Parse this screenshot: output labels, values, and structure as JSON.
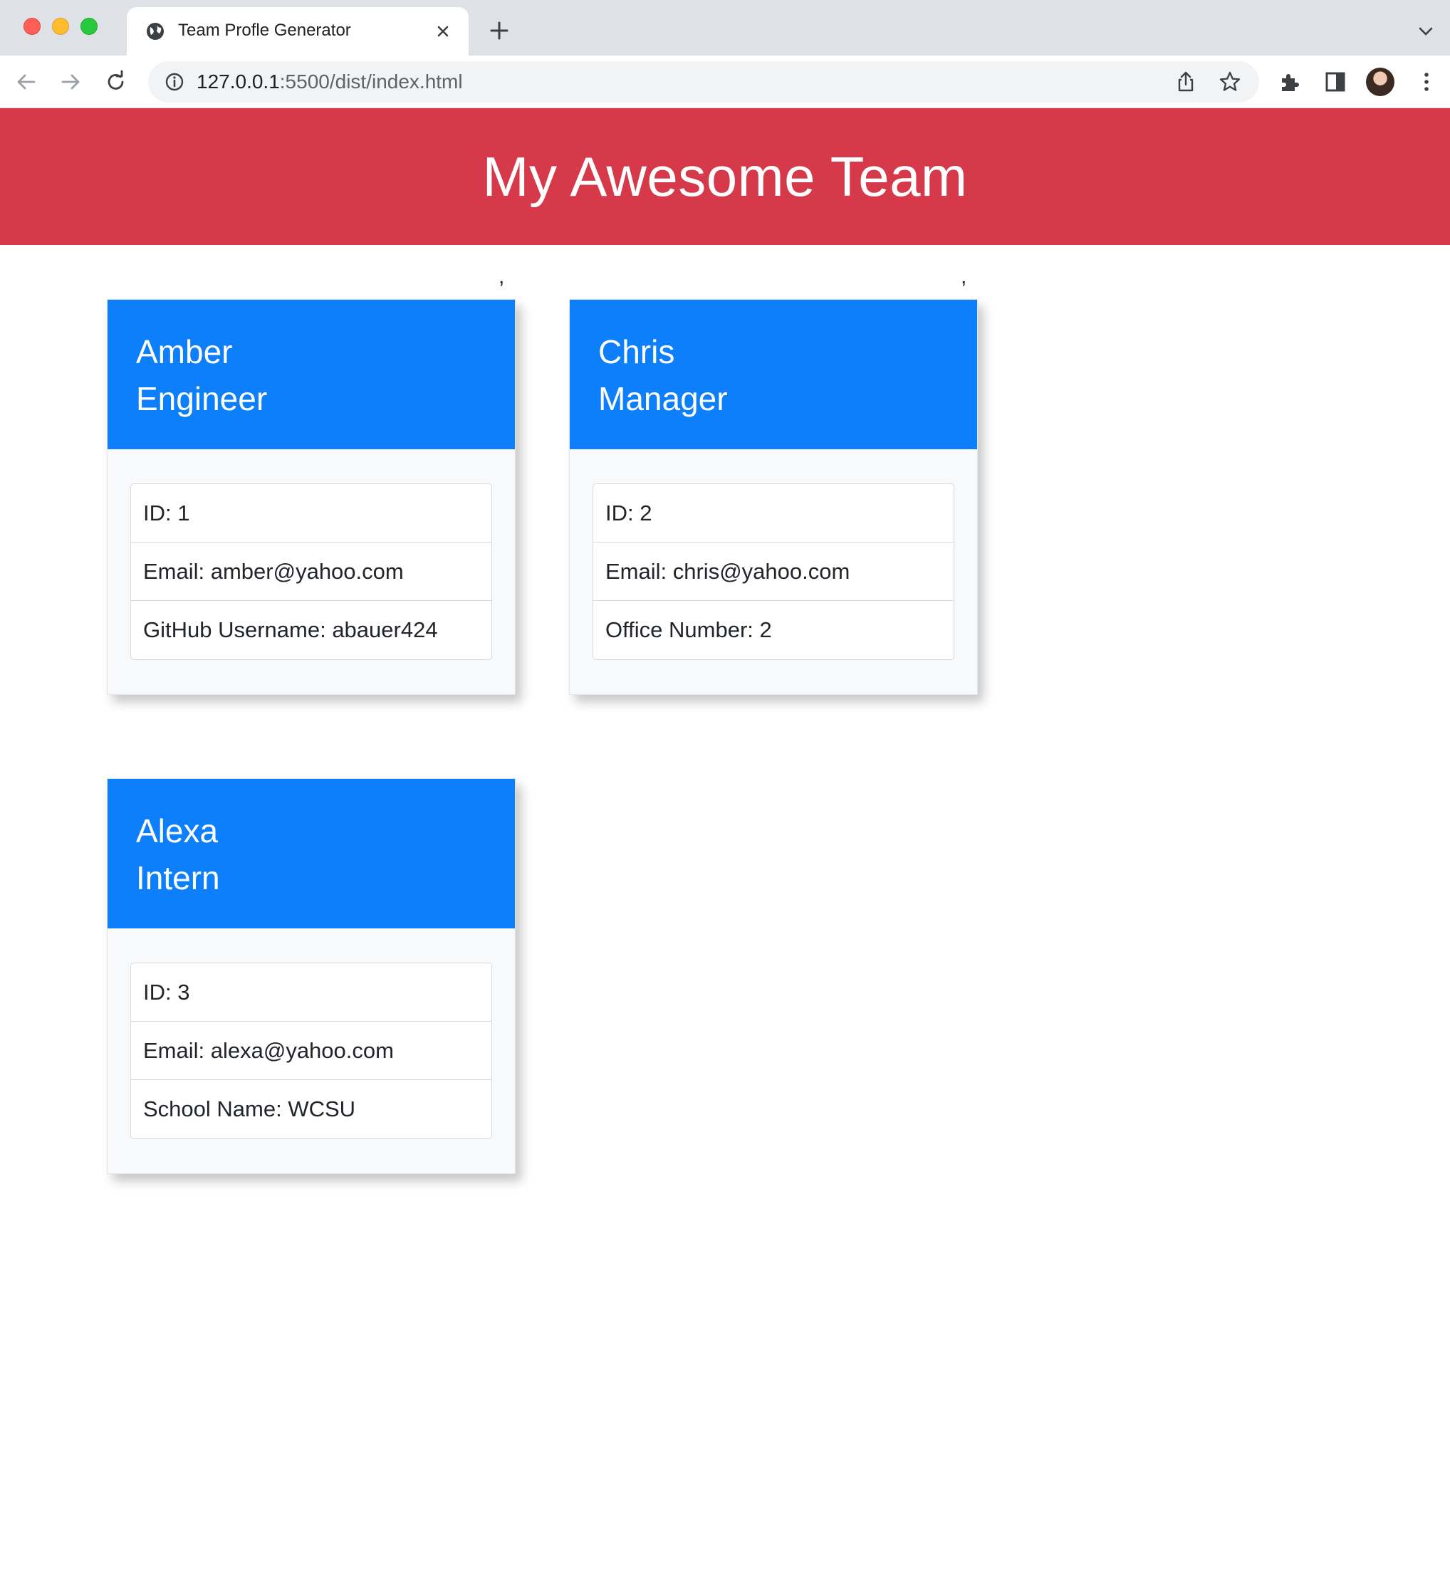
{
  "browser": {
    "tab_title": "Team Profle Generator",
    "url_host": "127.0.0.1",
    "url_rest": ":5500/dist/index.html"
  },
  "page": {
    "heading": "My Awesome Team",
    "stray_marks": [
      ",",
      ","
    ]
  },
  "employees": [
    {
      "name": "Amber",
      "role": "Engineer",
      "details": [
        "ID: 1",
        "Email: amber@yahoo.com",
        "GitHub Username: abauer424"
      ]
    },
    {
      "name": "Chris",
      "role": "Manager",
      "details": [
        "ID: 2",
        "Email: chris@yahoo.com",
        "Office Number: 2"
      ]
    },
    {
      "name": "Alexa",
      "role": "Intern",
      "details": [
        "ID: 3",
        "Email: alexa@yahoo.com",
        "School Name: WCSU"
      ]
    }
  ],
  "colors": {
    "header_bg": "#d63a4a",
    "card_header_bg": "#0d7ffb"
  }
}
